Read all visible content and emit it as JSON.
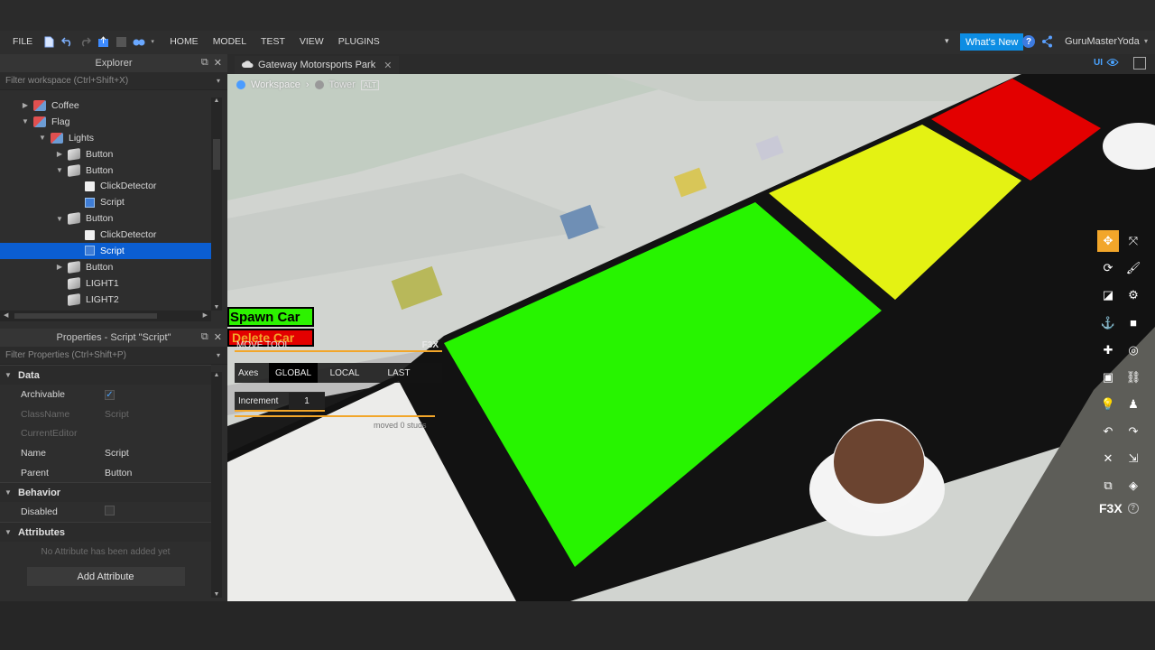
{
  "menubar": {
    "file": "FILE",
    "tabs": [
      "HOME",
      "MODEL",
      "TEST",
      "VIEW",
      "PLUGINS"
    ],
    "whats_new": "What's New",
    "username": "GuruMasterYoda"
  },
  "explorer": {
    "title": "Explorer",
    "filter_placeholder": "Filter workspace (Ctrl+Shift+X)",
    "items": [
      {
        "label": "Coffee",
        "icon": "model-icon",
        "indent": 1,
        "arrow": "collapsed"
      },
      {
        "label": "Flag",
        "icon": "model-icon",
        "indent": 1,
        "arrow": "expanded"
      },
      {
        "label": "Lights",
        "icon": "model-icon",
        "indent": 2,
        "arrow": "expanded"
      },
      {
        "label": "Button",
        "icon": "part-icon",
        "indent": 3,
        "arrow": "collapsed"
      },
      {
        "label": "Button",
        "icon": "part-icon",
        "indent": 3,
        "arrow": "expanded"
      },
      {
        "label": "ClickDetector",
        "icon": "click-detector-icon",
        "indent": 4,
        "arrow": ""
      },
      {
        "label": "Script",
        "icon": "script-icon",
        "indent": 4,
        "arrow": ""
      },
      {
        "label": "Button",
        "icon": "part-icon",
        "indent": 3,
        "arrow": "expanded"
      },
      {
        "label": "ClickDetector",
        "icon": "click-detector-icon",
        "indent": 4,
        "arrow": ""
      },
      {
        "label": "Script",
        "icon": "script-icon",
        "indent": 4,
        "arrow": "",
        "selected": true
      },
      {
        "label": "Button",
        "icon": "part-icon",
        "indent": 3,
        "arrow": "collapsed"
      },
      {
        "label": "LIGHT1",
        "icon": "part-icon",
        "indent": 3,
        "arrow": ""
      },
      {
        "label": "LIGHT2",
        "icon": "part-icon",
        "indent": 3,
        "arrow": ""
      }
    ]
  },
  "properties": {
    "title": "Properties - Script \"Script\"",
    "filter_placeholder": "Filter Properties (Ctrl+Shift+P)",
    "sections": {
      "data": "Data",
      "behavior": "Behavior",
      "attributes": "Attributes"
    },
    "rows": {
      "archivable": {
        "key": "Archivable",
        "checked": true
      },
      "classname": {
        "key": "ClassName",
        "value": "Script"
      },
      "currenteditor": {
        "key": "CurrentEditor",
        "value": ""
      },
      "name": {
        "key": "Name",
        "value": "Script"
      },
      "parent": {
        "key": "Parent",
        "value": "Button"
      },
      "disabled": {
        "key": "Disabled",
        "checked": false
      }
    },
    "no_attributes": "No Attribute has been added yet",
    "add_attribute": "Add Attribute"
  },
  "viewport": {
    "tab_label": "Gateway Motorsports Park",
    "breadcrumb": [
      "Workspace",
      "Tower"
    ],
    "breadcrumb_hint": "ALT",
    "ui_toggle": "UI",
    "spawn_car": "Spawn Car",
    "delete_car": "Delete Car",
    "move_tool": "MOVE TOOL",
    "f3x_badge": "F3X",
    "axes_label": "Axes",
    "axes_options": [
      "GLOBAL",
      "LOCAL",
      "LAST"
    ],
    "increment_label": "Increment",
    "increment_value": "1",
    "moved_status": "moved 0 studs",
    "f3x_logo": "F3X"
  },
  "colors": {
    "accent": "#0b5ed1",
    "whats_new": "#0d8de3",
    "pad_red": "#e30000",
    "pad_yellow": "#e4f213",
    "pad_green": "#27f400",
    "f3x_orange": "#f2a62a"
  }
}
